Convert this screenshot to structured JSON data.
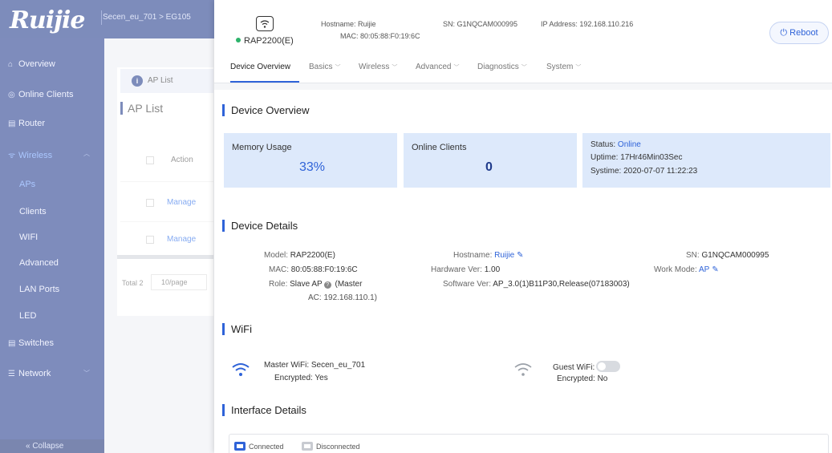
{
  "bg": {
    "logo": "Ruijie",
    "breadcrumb": "Secen_eu_701  >  EG105",
    "sidebar": {
      "overview": "Overview",
      "online_clients": "Online Clients",
      "router": "Router",
      "wireless": "Wireless",
      "aps": "APs",
      "clients": "Clients",
      "wifi": "WIFI",
      "advanced": "Advanced",
      "lan_ports": "LAN Ports",
      "led": "LED",
      "switches": "Switches",
      "network": "Network",
      "collapse": "« Collapse"
    },
    "ap_list_tab": "AP List",
    "ap_list_title": "AP List",
    "action_header": "Action",
    "manage_1": "Manage",
    "manage_2": "Manage",
    "total": "Total 2",
    "pager": "10/page"
  },
  "header": {
    "model": "RAP2200(E)",
    "hostname": "Hostname: Ruijie",
    "mac": "MAC: 80:05:88:F0:19:6C",
    "sn": "SN: G1NQCAM000995",
    "ip": "IP Address: 192.168.110.216",
    "reboot_label": "Reboot"
  },
  "tabs": [
    {
      "label": "Device Overview"
    },
    {
      "label": "Basics"
    },
    {
      "label": "Wireless"
    },
    {
      "label": "Advanced"
    },
    {
      "label": "Diagnostics"
    },
    {
      "label": "System"
    }
  ],
  "overview": {
    "title": "Device Overview",
    "memory_label": "Memory Usage",
    "memory_value": "33%",
    "clients_label": "Online Clients",
    "clients_value": "0",
    "status_prefix": "Status:",
    "status_value": "Online",
    "uptime": "Uptime: 17Hr46Min03Sec",
    "systime": "Systime: 2020-07-07 11:22:23"
  },
  "details": {
    "title": "Device Details",
    "model_label": "Model:",
    "model_value": "RAP2200(E)",
    "mac_label": "MAC:",
    "mac_value": "80:05:88:F0:19:6C",
    "role_label": "Role:",
    "role_value": "Slave AP",
    "role_master_1": "(Master",
    "role_master_2": "AC: 192.168.110.1)",
    "hostname_label": "Hostname:",
    "hostname_value": "Ruijie",
    "hw_label": "Hardware Ver:",
    "hw_value": "1.00",
    "sw_label": "Software Ver:",
    "sw_value": "AP_3.0(1)B11P30,Release(07183003)",
    "sn_label": "SN:",
    "sn_value": "G1NQCAM000995",
    "work_mode_label": "Work Mode:",
    "work_mode_value": "AP"
  },
  "wifi": {
    "title": "WiFi",
    "master_label": "Master WiFi: Secen_eu_701",
    "master_encrypted": "Encrypted: Yes",
    "guest_label": "Guest WiFi:",
    "guest_encrypted": "Encrypted: No"
  },
  "interface": {
    "title": "Interface Details",
    "connected": "Connected",
    "disconnected": "Disconnected"
  },
  "colors": {
    "accent": "#2f63d8",
    "brand": "#1f3a8a",
    "online": "#2db36b",
    "stat_box": "#dde9fb"
  }
}
